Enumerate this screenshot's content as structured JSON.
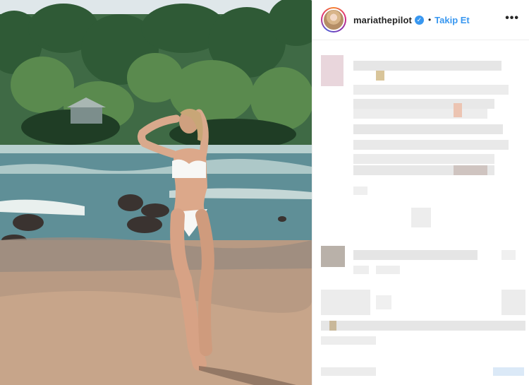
{
  "post": {
    "image_alt_icon": "beach-photo",
    "username": "mariathepilot",
    "verified": true,
    "separator": "•",
    "follow_label": "Takip Et",
    "more_icon": "more-options-icon"
  },
  "colors": {
    "accent": "#3897f0",
    "text": "#262626",
    "divider": "#efefef",
    "mosaic": "#e8e8e8"
  }
}
